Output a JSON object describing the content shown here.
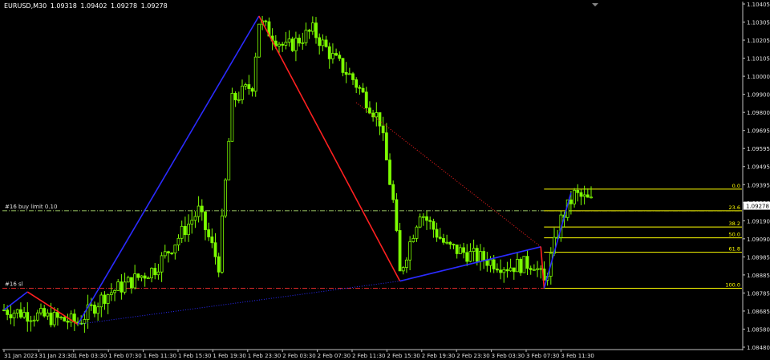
{
  "header": {
    "symbol": "EURUSD,M30",
    "open": "1.09318",
    "high": "1.09402",
    "low": "1.09278",
    "close": "1.09278"
  },
  "colors": {
    "background": "#000000",
    "candle": "#7CFC00",
    "grid_axis": "#c0c0c0",
    "wave_up": "#2b2bff",
    "wave_down": "#ff2020",
    "fib": "#ffff00",
    "order_line": "#c8ff80",
    "sl_line": "#ff3030"
  },
  "chart_data": {
    "type": "candlestick",
    "ylim": [
      1.0848,
      1.1041
    ],
    "y_ticks": [
      "1.10405",
      "1.10305",
      "1.10205",
      "1.10105",
      "1.10000",
      "1.09900",
      "1.09800",
      "1.09695",
      "1.09595",
      "1.09495",
      "1.09395",
      "1.09290",
      "1.09190",
      "1.09090",
      "1.08985",
      "1.08885",
      "1.08785",
      "1.08685",
      "1.08580",
      "1.08480"
    ],
    "x_ticks": [
      "31 Jan 2023",
      "31 Jan 23:30",
      "1 Feb 03:30",
      "1 Feb 07:30",
      "1 Feb 11:30",
      "1 Feb 15:30",
      "1 Feb 19:30",
      "1 Feb 23:30",
      "2 Feb 03:30",
      "2 Feb 07:30",
      "2 Feb 11:30",
      "2 Feb 15:30",
      "2 Feb 19:30",
      "2 Feb 23:30",
      "3 Feb 03:30",
      "3 Feb 07:30",
      "3 Feb 11:30"
    ],
    "current_price": "1.09278",
    "price_lines": [
      {
        "label": "#16 buy limit 0.10",
        "price": 1.0925,
        "style": "dash-dot"
      },
      {
        "label": "#16 sl",
        "price": 1.0882,
        "style": "dash-dot"
      }
    ],
    "fib_levels": [
      {
        "label": "0.0",
        "price": 1.0937
      },
      {
        "label": "23.6",
        "price": 1.0925
      },
      {
        "label": "38.2",
        "price": 1.0916
      },
      {
        "label": "50.0",
        "price": 1.091
      },
      {
        "label": "61.8",
        "price": 1.0902
      },
      {
        "label": "100.0",
        "price": 1.0882
      }
    ],
    "zigzag": [
      {
        "bar": 0,
        "price": 1.087
      },
      {
        "bar": 7,
        "price": 1.088
      },
      {
        "bar": 22,
        "price": 1.0862
      },
      {
        "bar": 76,
        "price": 1.1033
      },
      {
        "bar": 118,
        "price": 1.0886
      },
      {
        "bar": 160,
        "price": 1.0905
      },
      {
        "bar": 161,
        "price": 1.0882
      },
      {
        "bar": 169,
        "price": 1.0935
      }
    ],
    "key_points": [
      {
        "bar": 0,
        "price": 1.087
      },
      {
        "bar": 22,
        "price": 1.0863
      },
      {
        "bar": 30,
        "price": 1.0878
      },
      {
        "bar": 45,
        "price": 1.0893
      },
      {
        "bar": 58,
        "price": 1.0925
      },
      {
        "bar": 64,
        "price": 1.0895
      },
      {
        "bar": 68,
        "price": 1.0986
      },
      {
        "bar": 74,
        "price": 1.0995
      },
      {
        "bar": 76,
        "price": 1.103
      },
      {
        "bar": 84,
        "price": 1.1015
      },
      {
        "bar": 92,
        "price": 1.1025
      },
      {
        "bar": 98,
        "price": 1.101
      },
      {
        "bar": 104,
        "price": 1.0998
      },
      {
        "bar": 112,
        "price": 1.0975
      },
      {
        "bar": 116,
        "price": 1.093
      },
      {
        "bar": 118,
        "price": 1.089
      },
      {
        "bar": 124,
        "price": 1.0925
      },
      {
        "bar": 132,
        "price": 1.0905
      },
      {
        "bar": 140,
        "price": 1.09
      },
      {
        "bar": 150,
        "price": 1.0894
      },
      {
        "bar": 158,
        "price": 1.0896
      },
      {
        "bar": 161,
        "price": 1.0885
      },
      {
        "bar": 166,
        "price": 1.092
      },
      {
        "bar": 170,
        "price": 1.0934
      },
      {
        "bar": 175,
        "price": 1.093
      }
    ]
  }
}
